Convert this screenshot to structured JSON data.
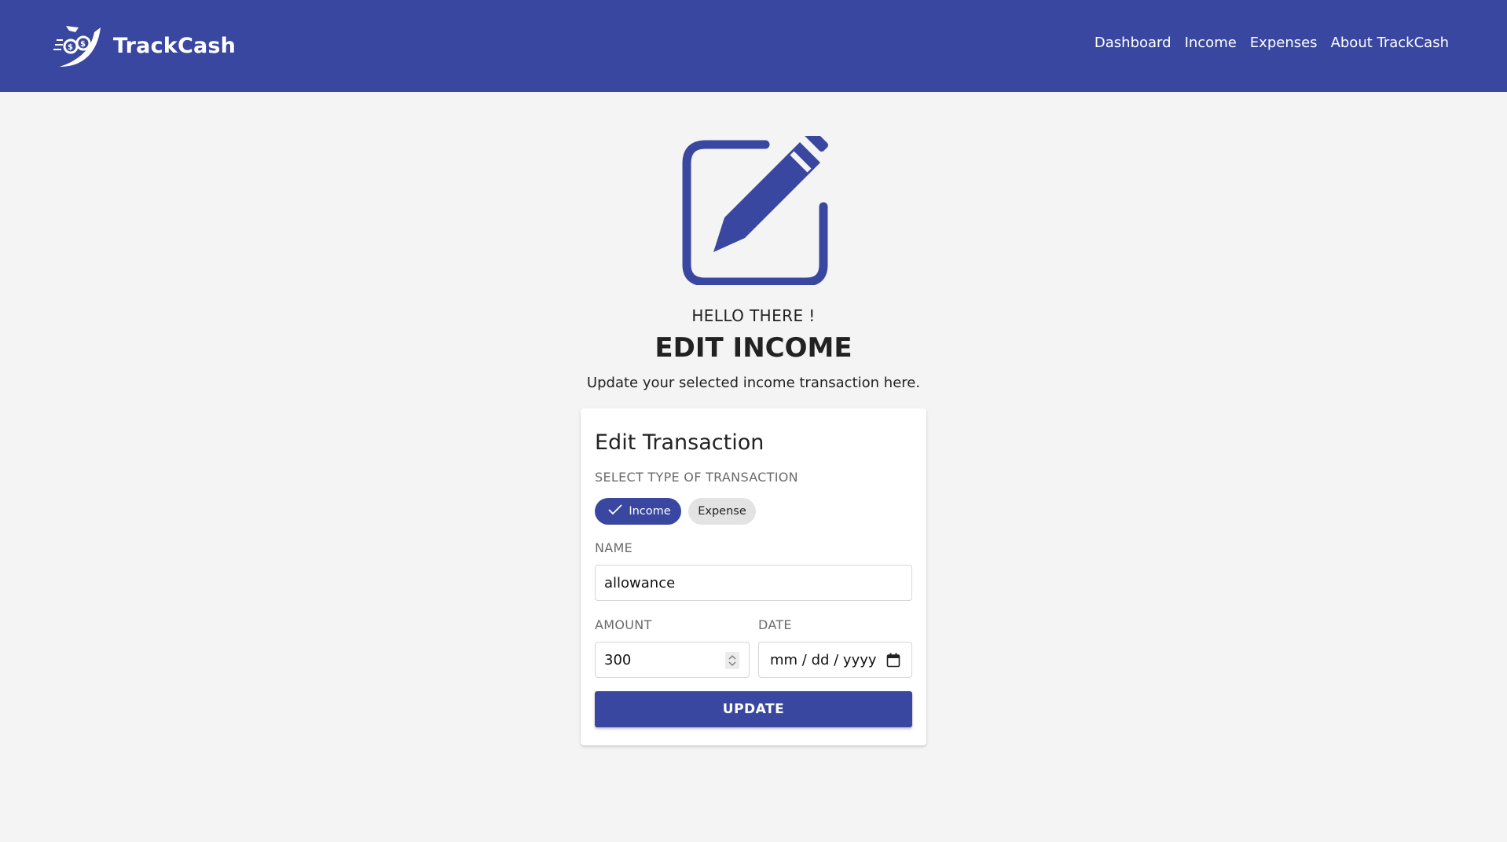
{
  "brand": {
    "name": "TrackCash",
    "logo_icon": "money-fly-icon"
  },
  "nav": {
    "items": [
      {
        "label": "Dashboard"
      },
      {
        "label": "Income"
      },
      {
        "label": "Expenses"
      },
      {
        "label": "About TrackCash"
      }
    ]
  },
  "hero": {
    "icon": "edit-square-icon",
    "greeting": "HELLO THERE !",
    "title": "EDIT INCOME",
    "subtitle": "Update your selected income transaction here."
  },
  "form": {
    "title": "Edit Transaction",
    "type_label": "SELECT TYPE OF TRANSACTION",
    "types": [
      {
        "label": "Income",
        "selected": true
      },
      {
        "label": "Expense",
        "selected": false
      }
    ],
    "name_label": "NAME",
    "name_value": "allowance",
    "amount_label": "AMOUNT",
    "amount_value": "300",
    "date_label": "DATE",
    "date_placeholder": "mm / dd / yyyy",
    "submit_label": "UPDATE"
  },
  "colors": {
    "primary": "#3947a0",
    "background": "#f4f4f4",
    "card": "#ffffff"
  }
}
